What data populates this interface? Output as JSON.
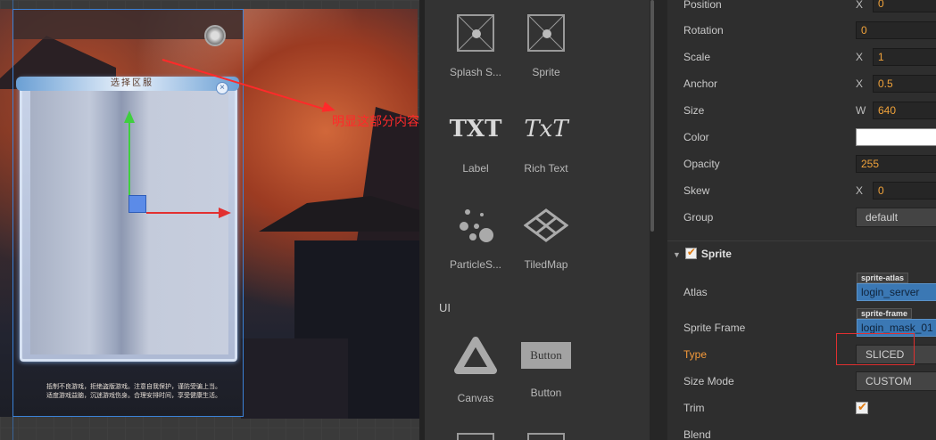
{
  "scene": {
    "panel_title": "选择区服",
    "corner_glyph": "×",
    "annotation": "明显这部分内容不见了",
    "notice_lines": [
      "抵制不良游戏，拒绝盗版游戏。注意自我保护，谨防受骗上当。",
      "适度游戏益脑，沉迷游戏伤身。合理安排时间，享受健康生活。"
    ]
  },
  "library": {
    "items": [
      {
        "label": "Splash S...",
        "icon": "splash-sprite-icon"
      },
      {
        "label": "Sprite",
        "icon": "sprite-icon"
      },
      {
        "label": "Label",
        "icon": "label-icon",
        "glyph": "TXT"
      },
      {
        "label": "Rich Text",
        "icon": "rich-text-icon",
        "glyph": "TxT"
      },
      {
        "label": "ParticleS...",
        "icon": "particle-system-icon"
      },
      {
        "label": "TiledMap",
        "icon": "tiledmap-icon"
      },
      {
        "label": "Canvas",
        "icon": "canvas-icon"
      },
      {
        "label": "Button",
        "icon": "button-icon",
        "glyph": "Button"
      }
    ],
    "section_ui": "UI"
  },
  "inspector": {
    "position": {
      "label": "Position",
      "axis": "X",
      "value": "0"
    },
    "rotation": {
      "label": "Rotation",
      "value": "0"
    },
    "scale": {
      "label": "Scale",
      "axis": "X",
      "value": "1"
    },
    "anchor": {
      "label": "Anchor",
      "axis": "X",
      "value": "0.5"
    },
    "size": {
      "label": "Size",
      "axis": "W",
      "value": "640"
    },
    "color": {
      "label": "Color",
      "value": "#ffffff"
    },
    "opacity": {
      "label": "Opacity",
      "value": "255"
    },
    "skew": {
      "label": "Skew",
      "axis": "X",
      "value": "0"
    },
    "group": {
      "label": "Group",
      "value": "default"
    },
    "sprite_section": {
      "label": "Sprite",
      "checked": true
    },
    "atlas": {
      "label": "Atlas",
      "tag": "sprite-atlas",
      "value": "login_server"
    },
    "sprite_frame": {
      "label": "Sprite Frame",
      "tag": "sprite-frame",
      "value": "login_mask_01"
    },
    "type": {
      "label": "Type",
      "value": "SLICED"
    },
    "size_mode": {
      "label": "Size Mode",
      "value": "CUSTOM"
    },
    "trim": {
      "label": "Trim",
      "checked": true
    },
    "blend": {
      "label": "Blend"
    }
  }
}
